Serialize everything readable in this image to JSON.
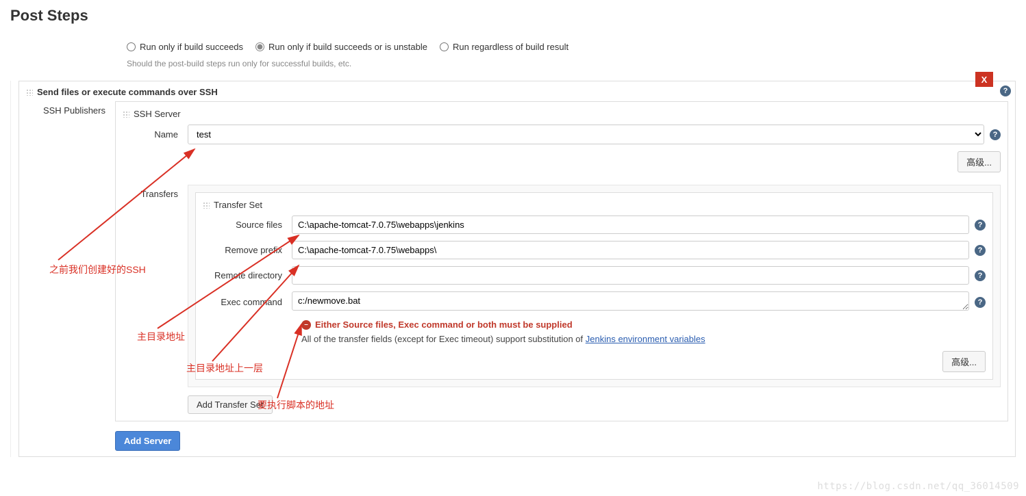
{
  "page_title": "Post Steps",
  "run_options": {
    "opt1": "Run only if build succeeds",
    "opt2": "Run only if build succeeds or is unstable",
    "opt3": "Run regardless of build result",
    "selected": "opt2"
  },
  "help_line": "Should the post-build steps run only for successful builds, etc.",
  "ssh_block": {
    "title": "Send files or execute commands over SSH",
    "close_label": "X",
    "publishers_label": "SSH Publishers",
    "server": {
      "header": "SSH Server",
      "name_label": "Name",
      "name_value": "test",
      "advanced_btn": "高级..."
    },
    "transfers": {
      "label": "Transfers",
      "set_header": "Transfer Set",
      "source_files_label": "Source files",
      "source_files_value": "C:\\apache-tomcat-7.0.75\\webapps\\jenkins",
      "remove_prefix_label": "Remove prefix",
      "remove_prefix_value": "C:\\apache-tomcat-7.0.75\\webapps\\",
      "remote_dir_label": "Remote directory",
      "remote_dir_value": "",
      "exec_cmd_label": "Exec command",
      "exec_cmd_value_pre": "c:/",
      "exec_cmd_value_mid": "newmove",
      "exec_cmd_value_post": ".bat",
      "error_msg": "Either Source files, Exec command or both must be supplied",
      "info_text_pre": "All of the transfer fields (except for Exec timeout) support substitution of ",
      "info_link": "Jenkins environment variables",
      "advanced_btn": "高级...",
      "add_transfer_btn": "Add Transfer Set"
    },
    "add_server_btn": "Add Server"
  },
  "annotations": {
    "a1": "之前我们创建好的SSH",
    "a2": "主目录地址",
    "a3": "主目录地址上一层",
    "a4": "要执行脚本的地址"
  },
  "watermark": "https://blog.csdn.net/qq_36014509"
}
